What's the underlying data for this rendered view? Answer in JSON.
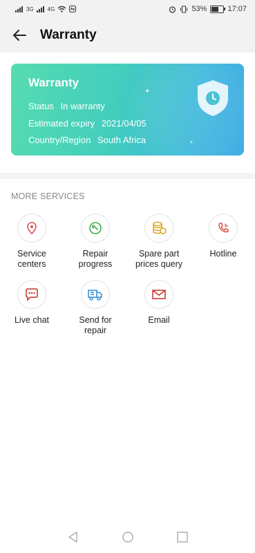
{
  "status_bar": {
    "network_left": "3G",
    "network_right": "4G",
    "battery": "53%",
    "time": "17:07"
  },
  "header": {
    "title": "Warranty"
  },
  "card": {
    "title": "Warranty",
    "rows": [
      {
        "label": "Status",
        "value": "In warranty"
      },
      {
        "label": "Estimated expiry",
        "value": "2021/04/05"
      },
      {
        "label": "Country/Region",
        "value": "South Africa"
      }
    ]
  },
  "more_services": {
    "title": "MORE SERVICES",
    "items": [
      {
        "label": "Service centers",
        "icon": "location-pin-icon"
      },
      {
        "label": "Repair progress",
        "icon": "wrench-icon"
      },
      {
        "label": "Spare part prices query",
        "icon": "coins-icon"
      },
      {
        "label": "Hotline",
        "icon": "phone-icon"
      },
      {
        "label": "Live chat",
        "icon": "chat-bubble-icon"
      },
      {
        "label": "Send for repair",
        "icon": "delivery-truck-icon"
      },
      {
        "label": "Email",
        "icon": "envelope-icon"
      }
    ]
  },
  "colors": {
    "card_gradient_start": "#56dcb1",
    "card_gradient_end": "#39a9e3",
    "location_red": "#d9534f",
    "wrench_green": "#3ea84a",
    "coins_gold": "#e0a21c",
    "phone_red": "#d9534f",
    "chat_red": "#c9302c",
    "truck_blue": "#2f8bd6",
    "email_red": "#c9302c"
  }
}
